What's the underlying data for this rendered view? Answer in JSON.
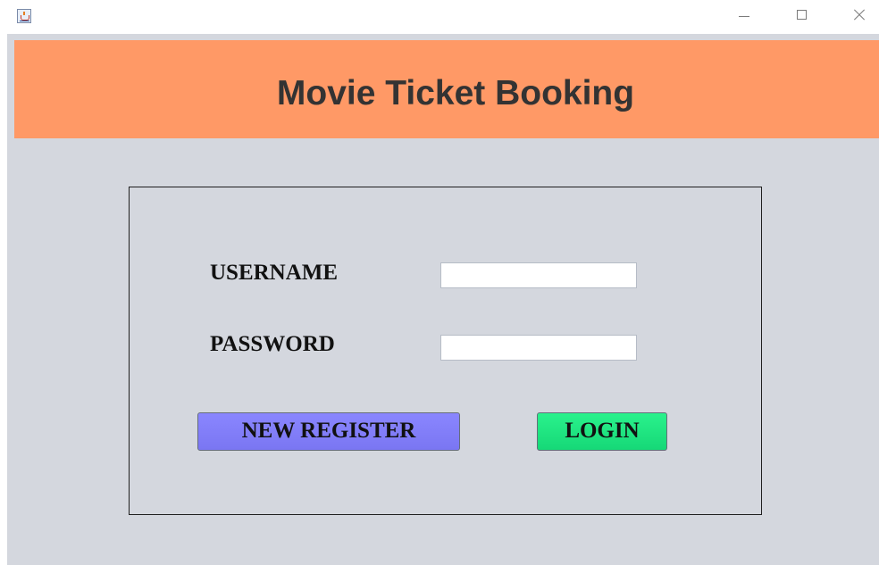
{
  "window": {
    "icon": "java-cup-icon",
    "controls": [
      "minimize-icon",
      "maximize-icon",
      "close-icon"
    ]
  },
  "header": {
    "title": "Movie Ticket Booking",
    "background": "#ff9966"
  },
  "form": {
    "username_label": "USERNAME",
    "username_value": "",
    "password_label": "PASSWORD",
    "password_value": ""
  },
  "buttons": {
    "register_label": "NEW REGISTER",
    "register_color": "#7c78f5",
    "login_label": "LOGIN",
    "login_color": "#1ee07f"
  }
}
